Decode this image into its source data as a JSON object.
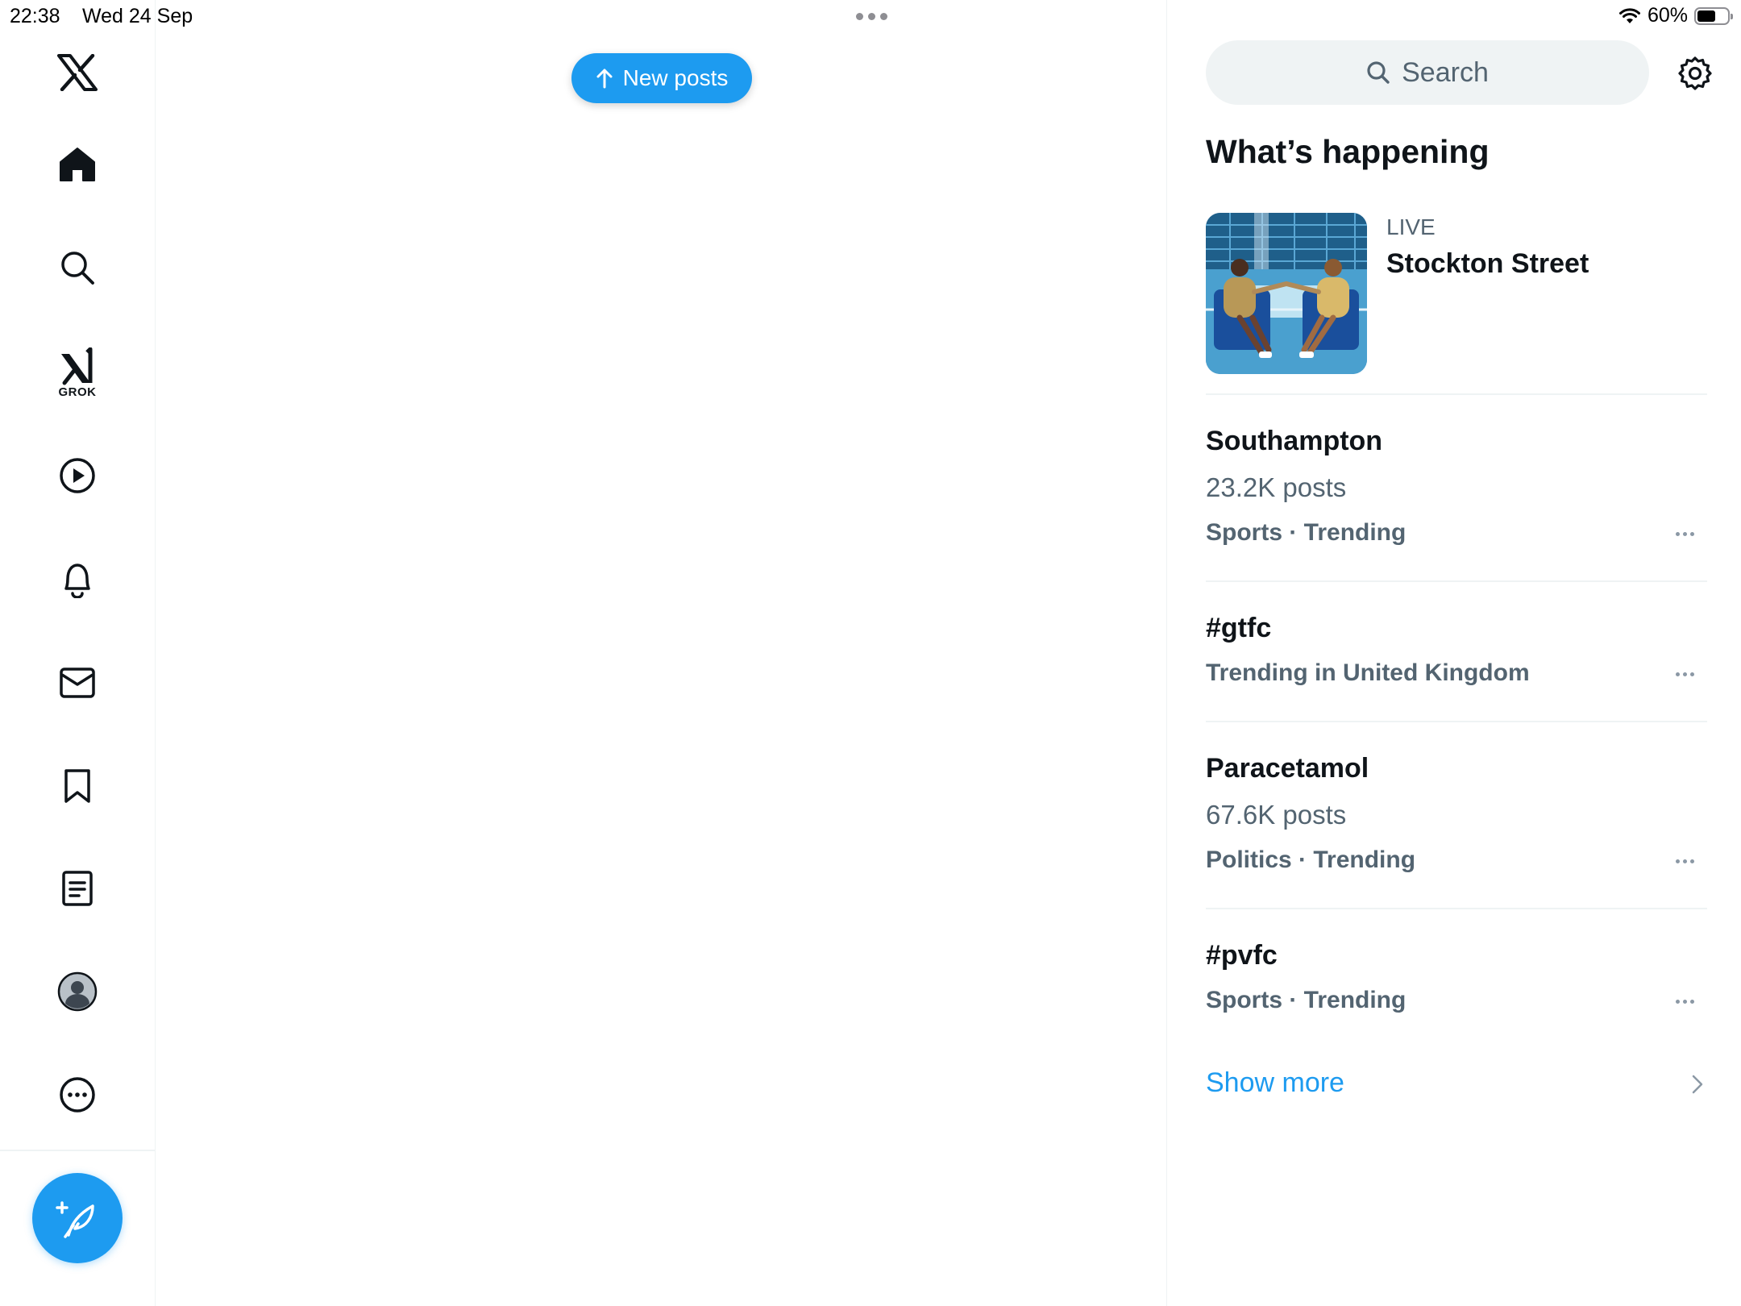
{
  "status_bar": {
    "time": "22:38",
    "date": "Wed 24 Sep",
    "battery_percent": "60%",
    "battery_level": 0.6
  },
  "sidebar": {
    "grok_label": "GROK",
    "items": [
      {
        "icon": "x-logo-icon"
      },
      {
        "icon": "home-icon",
        "active": true
      },
      {
        "icon": "search-icon"
      },
      {
        "icon": "grok-icon"
      },
      {
        "icon": "video-play-icon"
      },
      {
        "icon": "bell-icon"
      },
      {
        "icon": "mail-icon"
      },
      {
        "icon": "bookmark-icon"
      },
      {
        "icon": "lists-icon"
      },
      {
        "icon": "profile-avatar-icon"
      },
      {
        "icon": "more-circle-icon"
      }
    ],
    "compose_icon": "compose-feather-icon"
  },
  "main": {
    "new_posts_label": "New posts"
  },
  "right": {
    "search_placeholder": "Search",
    "section_title": "What’s happening",
    "live": {
      "label": "LIVE",
      "title": "Stockton Street"
    },
    "trends": [
      {
        "title": "Southampton",
        "count": "23.2K posts",
        "meta": "Sports · Trending"
      },
      {
        "title": "#gtfc",
        "count": "",
        "meta": "Trending in United Kingdom"
      },
      {
        "title": "Paracetamol",
        "count": "67.6K posts",
        "meta": "Politics · Trending"
      },
      {
        "title": "#pvfc",
        "count": "",
        "meta": "Sports · Trending"
      }
    ],
    "show_more_label": "Show more"
  },
  "colors": {
    "accent": "#1d9bf0",
    "text_primary": "#0f1419",
    "text_secondary": "#536471",
    "divider": "#eff3f4",
    "search_bg": "#eff3f4"
  }
}
